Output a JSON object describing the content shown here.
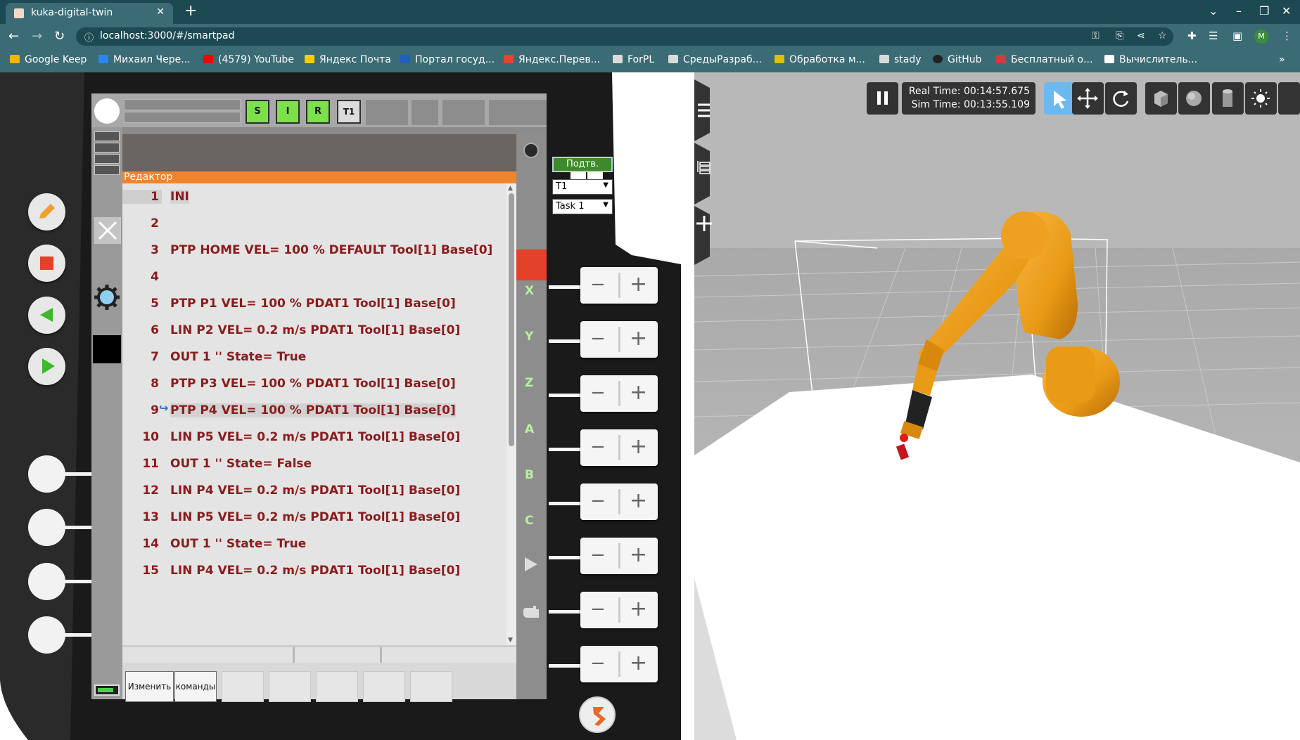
{
  "browser": {
    "tab_title": "kuka-digital-twin",
    "url": "localhost:3000/#/smartpad",
    "profile_initial": "M",
    "bookmarks": [
      {
        "label": "Google Keep",
        "color": "#f5b400"
      },
      {
        "label": "Михаил Чере...",
        "color": "#2787f5"
      },
      {
        "label": "(4579) YouTube",
        "color": "#ff0000"
      },
      {
        "label": "Яндекс Почта",
        "color": "#ffcc00"
      },
      {
        "label": "Портал госуд...",
        "color": "#1f5fbf"
      },
      {
        "label": "Яндекс.Перев...",
        "color": "#e8442e"
      },
      {
        "label": "ForPL",
        "color": "#dadada"
      },
      {
        "label": "СредыРазраб...",
        "color": "#dadada"
      },
      {
        "label": "Обработка м...",
        "color": "#e0c000"
      },
      {
        "label": "stady",
        "color": "#dadada"
      },
      {
        "label": "GitHub",
        "color": "#222222"
      },
      {
        "label": "Бесплатный о...",
        "color": "#d23b3b"
      },
      {
        "label": "Вычислитель...",
        "color": "#ffffff"
      }
    ]
  },
  "smartpad": {
    "status": {
      "s": "S",
      "i": "I",
      "r": "R",
      "mode": "T1"
    },
    "editor_title": "Редактор",
    "code_lines": [
      {
        "num": "1",
        "text": "INI"
      },
      {
        "num": "2",
        "text": ""
      },
      {
        "num": "3",
        "text": "PTP HOME VEL= 100 % DEFAULT Tool[1] Base[0]"
      },
      {
        "num": "4",
        "text": ""
      },
      {
        "num": "5",
        "text": "PTP P1 VEL= 100 % PDAT1 Tool[1] Base[0]"
      },
      {
        "num": "6",
        "text": "LIN P2 VEL= 0.2 m/s PDAT1 Tool[1] Base[0]"
      },
      {
        "num": "7",
        "text": "OUT 1 '' State= True"
      },
      {
        "num": "8",
        "text": "PTP P3 VEL= 100 % PDAT1 Tool[1] Base[0]"
      },
      {
        "num": "9",
        "text": "PTP P4 VEL= 100 % PDAT1 Tool[1] Base[0]"
      },
      {
        "num": "10",
        "text": "LIN P5 VEL= 0.2 m/s PDAT1 Tool[1] Base[0]"
      },
      {
        "num": "11",
        "text": "OUT 1 '' State= False"
      },
      {
        "num": "12",
        "text": "LIN P4 VEL= 0.2 m/s PDAT1 Tool[1] Base[0]"
      },
      {
        "num": "13",
        "text": "LIN P5 VEL= 0.2 m/s PDAT1 Tool[1] Base[0]"
      },
      {
        "num": "14",
        "text": "OUT 1 '' State= True"
      },
      {
        "num": "15",
        "text": "LIN P4 VEL= 0.2 m/s PDAT1 Tool[1] Base[0]"
      }
    ],
    "current_line": "9",
    "softkeys": {
      "change": "Изменить",
      "commands": "команды"
    },
    "confirm_label": "Подтв.",
    "mode_select": "T1",
    "task_select": "Task 1",
    "axes": [
      "X",
      "Y",
      "Z",
      "A",
      "B",
      "C"
    ]
  },
  "viewport": {
    "real_time": "Real Time: 00:14:57.675",
    "sim_time": "Sim Time: 00:13:55.109",
    "robot_color": "#f0a020"
  }
}
